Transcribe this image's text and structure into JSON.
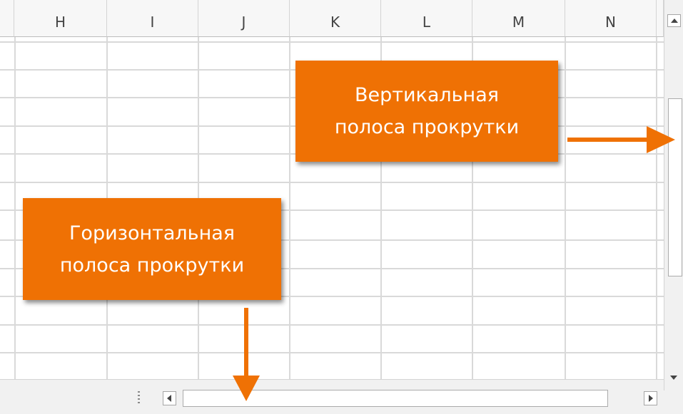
{
  "spreadsheet": {
    "columns": [
      "H",
      "I",
      "J",
      "K",
      "L",
      "M",
      "N"
    ]
  },
  "callouts": {
    "vertical": {
      "line1": "Вертикальная",
      "line2": "полоса прокрутки"
    },
    "horizontal": {
      "line1": "Горизонтальная",
      "line2": "полоса прокрутки"
    }
  },
  "icons": {
    "scroll_up": "scroll-up-arrow-icon",
    "scroll_down": "scroll-down-arrow-icon",
    "scroll_left": "scroll-left-arrow-icon",
    "scroll_right": "scroll-right-arrow-icon",
    "callout_arrow_right": "arrow-right-icon",
    "callout_arrow_down": "arrow-down-icon"
  },
  "colors": {
    "callout_background": "#ef7104",
    "callout_text": "#ffffff",
    "gridline": "#d9d9d9",
    "scrollbar_track": "#f1f1f1"
  }
}
